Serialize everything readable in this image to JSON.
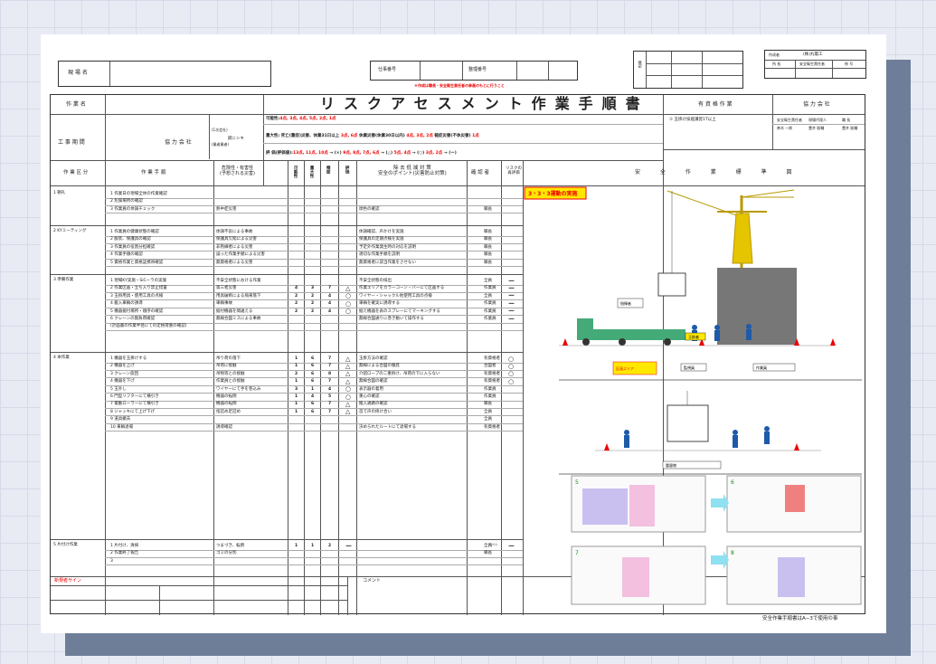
{
  "doc": {
    "title": "リスクアセスメント作業手順書",
    "genba_label": "現 場 名",
    "shigoto_no_label": "仕事番号",
    "seiri_no_label": "整理番号",
    "note_red": "＊作成は職長・安全衛生責任者の参画のもとに行うこと",
    "kakunin_label": "確認",
    "company_top": {
      "label": "作成者",
      "name": "(株)丸電工",
      "c1": "所 長",
      "c2": "安全衛生責任者",
      "c3": "係 号"
    },
    "sakugyo_mei_label": "作 業 名",
    "koji_kikan_label": "工 事 期 間",
    "kyoryoku_label": "協 力 会 社",
    "kyoryoku_detail1": "(1次会社)",
    "kyoryoku_detail2": "(業者業者)",
    "kyoryoku_name": "鋼ニシキ",
    "possibility_line": {
      "label": "可能性:",
      "vals": "4点, 3点, 4点, 5点, 2点, 1点"
    },
    "severity_line": {
      "label": "重大性: 死亡(重症)災害、休業31日以上",
      "vals": "3点, 6点",
      "mid": "休業災害(休業30日以内)",
      "vals2": "4点, 3点, 2点",
      "end": "軽症災害(不休災害)",
      "vals3": "1点"
    },
    "eval_line": {
      "label": "評 価(評価値):",
      "vals": "13点, 11点, 10点",
      "t1": "→ (×)",
      "v2": "9点, 8点, 7点, 6点",
      "t2": "→ (△)",
      "v3": "5点, 4点",
      "t3": "→ (○)",
      "v4": "3点, 2点",
      "t4": "→ (ー)"
    },
    "shikaku_label": "有 資 格 作 業",
    "shikaku_item": "① 玉掛け技能講習1T以上",
    "kyoryoku_right_label": "協 力 会 社",
    "kyoryoku_right_rows": [
      [
        "安全衛生責任者",
        "現場代理人",
        "職 長"
      ],
      [
        "斉木 一郎",
        "豊井 聡輔",
        "豊井 聡輔"
      ]
    ],
    "headers": {
      "kubun": "作 業 区 分",
      "tejun": "作 業 手 順",
      "kiken1": "危険性・有害性",
      "kiken2": "(予想される災害)",
      "kanou": "可能性",
      "judai": "重大性",
      "hindo": "頻度",
      "hyoka": "評価",
      "jokyo1": "除 去 低 減 対 策",
      "jokyo2": "安全のポイント(災害防止対策)",
      "kakuninsha": "確 認 者",
      "risk1": "リスクの",
      "risk2": "再評価",
      "zu": "安 全 作 業 標 準 図"
    },
    "sections": [
      {
        "kubun": "1 朝礼",
        "rows": [
          [
            "1 作業日の現場全体の作業確認",
            "",
            "",
            "",
            "",
            "",
            "",
            ""
          ],
          [
            "2 危険場所の確認",
            "",
            "",
            "",
            "",
            "",
            "",
            ""
          ],
          [
            "3 作業員の体調チェック",
            "熱中症災害",
            "",
            "",
            "",
            "",
            "顔色の確認",
            "職長"
          ]
        ]
      },
      {
        "kubun": "2 KYミーティング",
        "rows": [
          [
            "1 作業員の健康状態の確認",
            "体調不良による事故",
            "",
            "",
            "",
            "",
            "体調確認、声かけを実施",
            "職長"
          ],
          [
            "2 服装、保護具の確認",
            "保護具欠陥による災害",
            "",
            "",
            "",
            "",
            "保護具の定期点検を実施",
            "職長"
          ],
          [
            "3 作業員の役割分担確認",
            "非熟練者による災害",
            "",
            "",
            "",
            "",
            "予定外作業発生時の対応を説明",
            "職長"
          ],
          [
            "4 作業手順の確認",
            "誤った作業手順による災害",
            "",
            "",
            "",
            "",
            "適切な作業手順を説明",
            "職長"
          ],
          [
            "5 資格作業と資格証携帯確認",
            "無資格者による災害",
            "",
            "",
            "",
            "",
            "無資格者に該当作業をさせない",
            "職長"
          ]
        ]
      },
      {
        "kubun": "3 準備作業",
        "rows": [
          [
            "1 現場KY実施・SiCーラの実施",
            "不安全状態における作業",
            "",
            "",
            "",
            "",
            "不安全状態の排出",
            "全員"
          ],
          [
            "2 作業区画・立ち入り禁止措置",
            "第三者災害",
            "4",
            "3",
            "7",
            "△",
            "作業エリアをカラーコーン・バーにて区画する",
            "作業員"
          ],
          [
            "3 玉掛用具・使用工具の点検",
            "用具破断による飛来落下",
            "2",
            "2",
            "4",
            "○",
            "ワイヤー・シャックル他使用工具の点検",
            "全員"
          ],
          [
            "4 搬入車輌の誘導",
            "車輌事故",
            "2",
            "2",
            "4",
            "○",
            "車輌を確実に誘導する",
            "作業員"
          ],
          [
            "5 機器据付場所・順序の確認",
            "据付機器を間違える",
            "2",
            "2",
            "4",
            "○",
            "据え機器を表のスプレーにてマーキングする",
            "作業員"
          ],
          [
            "6 クレーンの無負荷確認",
            "無線合図ミスによる事故",
            "",
            "",
            "",
            "",
            "無線合図通りに巻き動いて操作する",
            "作業員"
          ],
          [
            "(計画書の作業半径にての定格荷重の確認)",
            "",
            "",
            "",
            "",
            "",
            "",
            ""
          ]
        ]
      },
      {
        "kubun": "4 本作業",
        "rows": [
          [
            "1 機器を玉掛けする",
            "吊り荷の落下",
            "1",
            "6",
            "7",
            "△",
            "玉掛方法の確認",
            "有資格者"
          ],
          [
            "2 機器を上げ",
            "吊荷に接触",
            "1",
            "6",
            "7",
            "△",
            "無線による合図の徹底",
            "合図者"
          ],
          [
            "3 クレーン旋回",
            "吊物等との接触",
            "2",
            "6",
            "8",
            "△",
            "介錯ロープの二重掛け、吊荷の下に入らない",
            "有資格者"
          ],
          [
            "4 機器を下げ",
            "作業員との接触",
            "1",
            "6",
            "7",
            "△",
            "無線合図の確認",
            "有資格者"
          ],
          [
            "5 玉外し",
            "ワイヤーにて手を巻込み",
            "3",
            "1",
            "4",
            "○",
            "表示器の着用",
            "作業員"
          ],
          [
            "6 門型リフターにて横引き",
            "機器の転倒",
            "1",
            "4",
            "5",
            "○",
            "重心の確認",
            "作業員"
          ],
          [
            "7 電動ローラーにて横引き",
            "機器の転倒",
            "1",
            "6",
            "7",
            "△",
            "搬入通路の確認",
            "職長"
          ],
          [
            "8 ジャッキにて上げ下げ",
            "指詰め足詰め",
            "1",
            "6",
            "7",
            "△",
            "首で声の掛け合い",
            "全員"
          ],
          [
            "9 道具撤去",
            "",
            "",
            "",
            "",
            "",
            "",
            "全員"
          ],
          [
            "10 車輌退場",
            "誘導確認",
            "",
            "",
            "",
            "",
            "決められたルートにて退場する",
            "有資格者"
          ]
        ]
      },
      {
        "kubun": "5 片付け作業",
        "rows": [
          [
            "1 片付け、清掃",
            "つまづき、転倒",
            "1",
            "1",
            "2",
            "ー",
            "",
            "全員"
          ],
          [
            "2 作業終了報告",
            "ゴミの分別",
            "",
            "",
            "",
            "",
            "",
            "職長"
          ],
          [
            "3",
            "",
            "",
            "",
            "",
            "",
            "",
            ""
          ]
        ]
      }
    ],
    "risk_marks4": [
      "○",
      "○",
      "○",
      "○",
      "",
      "",
      "",
      "",
      "",
      ""
    ],
    "risk_marks3": [
      "ー",
      "ー",
      "ー",
      "ー",
      "ー",
      "ー",
      ""
    ],
    "risk_marks5": [
      "ー",
      "",
      ""
    ],
    "cross_out": "ryuu",
    "signature_label": "新規者サイン",
    "comment_label": "コメント",
    "footer": "安全作業手順書はA−3で使用の事",
    "diagram": {
      "badge": "3・3・3運動の実施",
      "labels": [
        "安全帯",
        "玉掛者",
        "合図者",
        "区画エリア",
        "監視員",
        "作業員",
        "重量物",
        "指揮者"
      ],
      "steps": [
        "5",
        "6",
        "7",
        "8"
      ]
    }
  }
}
